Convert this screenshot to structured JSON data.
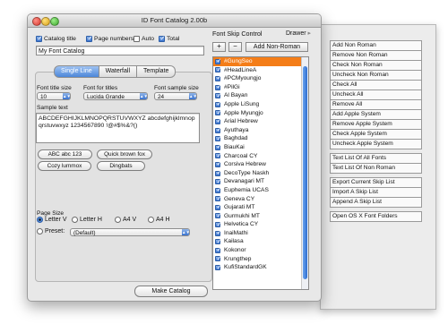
{
  "window": {
    "title": "ID Font Catalog 2.00b"
  },
  "top_options": {
    "catalog_title": {
      "label": "Catalog title",
      "checked": true
    },
    "page_numbers": {
      "label": "Page numbers",
      "checked": true
    },
    "auto": {
      "label": "Auto",
      "checked": false
    },
    "total": {
      "label": "Total",
      "checked": true
    },
    "title_value": "My Font Catalog"
  },
  "tabs": [
    "Single Line",
    "Waterfall",
    "Template"
  ],
  "settings": {
    "font_title_size_label": "Font title size",
    "font_title_size_value": "10",
    "font_for_titles_label": "Font for titles",
    "font_for_titles_value": "Lucida Grande",
    "font_sample_size_label": "Font sample size",
    "font_sample_size_value": "24",
    "sample_text_label": "Sample text",
    "sample_text": "ABCDEFGHIJKLMNOPQRSTUVWXYZ abcdefghijklmnopqrstuvwxyz 1234567890 !@#$%&?()",
    "presets": [
      "ABC abc 123",
      "Quick brown fox",
      "Cozy lummox",
      "Dingbats"
    ],
    "page_size_label": "Page Size",
    "page_sizes": [
      "Letter V",
      "Letter H",
      "A4 V",
      "A4 H"
    ],
    "selected_page_size": "Letter V",
    "preset_label": "Preset:",
    "preset_value": "(Default)"
  },
  "make_catalog": "Make Catalog",
  "skip_control": {
    "title": "Font Skip Control",
    "drawer_label": "Drawer",
    "add_label": "+",
    "remove_label": "−",
    "add_non_roman": "Add Non-Roman",
    "fonts": [
      "#GungSeo",
      "#HeadLineA",
      "#PCMyoungjo",
      "#PilGi",
      "Al Bayan",
      "Apple LiSung",
      "Apple Myungjo",
      "Arial Hebrew",
      "Ayuthaya",
      "Baghdad",
      "BiauKai",
      "Charcoal CY",
      "Corsiva Hebrew",
      "DecoType Naskh",
      "Devanagari MT",
      "Euphemia UCAS",
      "Geneva CY",
      "Gujarati MT",
      "Gurmukhi MT",
      "Helvetica CY",
      "InaiMathi",
      "Kailasa",
      "Kokonor",
      "Krungthep",
      "KufiStandardGK"
    ]
  },
  "drawer": {
    "group1": [
      "Add Non Roman",
      "Remove Non Roman",
      "Check Non Roman",
      "Uncheck Non Roman",
      "Check All",
      "Uncheck All",
      "Remove All",
      "Add Apple System",
      "Remove Apple System",
      "Check Apple System",
      "Uncheck Apple System"
    ],
    "group2": [
      "Text List Of All Fonts",
      "Text List Of Non Roman"
    ],
    "group3": [
      "Export Current Skip List",
      "Import A Skip List",
      "Append A Skip List"
    ],
    "group4": [
      "Open OS X Font Folders"
    ]
  }
}
